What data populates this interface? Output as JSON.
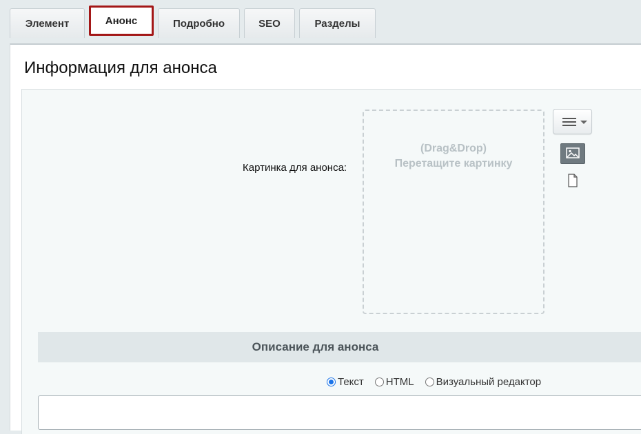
{
  "tabs": [
    {
      "label": "Элемент",
      "active": false
    },
    {
      "label": "Анонс",
      "active": true
    },
    {
      "label": "Подробно",
      "active": false
    },
    {
      "label": "SEO",
      "active": false
    },
    {
      "label": "Разделы",
      "active": false
    }
  ],
  "section": {
    "title": "Информация для анонса"
  },
  "preview_picture": {
    "label": "Картинка для анонса:",
    "dropzone_line1": "(Drag&Drop)",
    "dropzone_line2": "Перетащите картинку"
  },
  "description": {
    "header": "Описание для анонса",
    "modes": [
      {
        "label": "Текст",
        "checked": true
      },
      {
        "label": "HTML",
        "checked": false
      },
      {
        "label": "Визуальный редактор",
        "checked": false
      }
    ],
    "value": ""
  },
  "colors": {
    "active_tab_border": "#a31717",
    "radio_selected": "#1a73e8"
  }
}
